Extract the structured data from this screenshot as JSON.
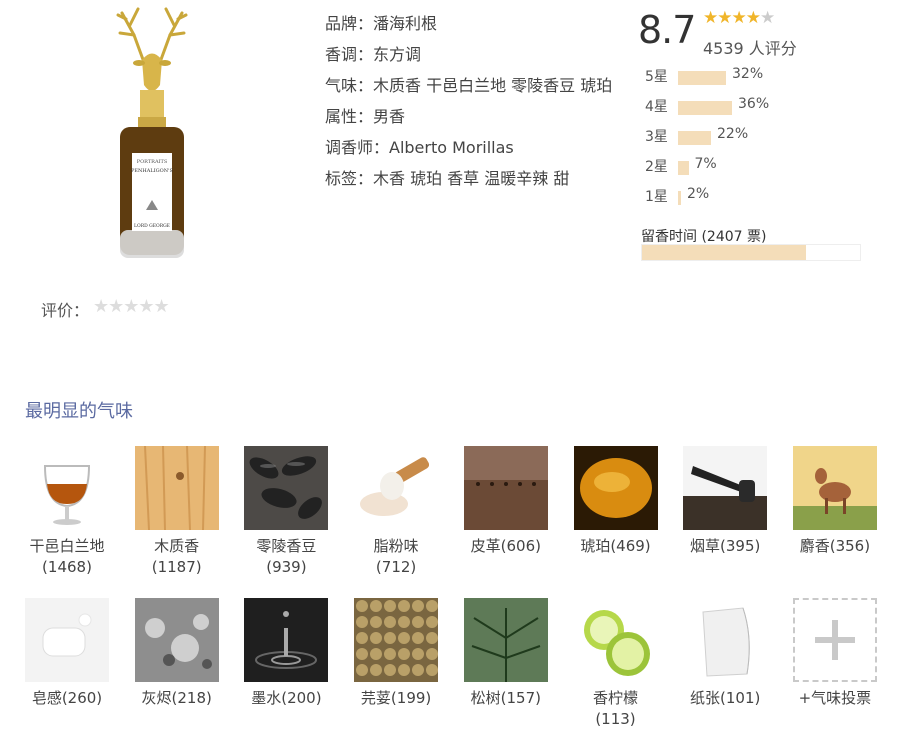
{
  "product": {
    "brand_label": "品牌：潘海利根",
    "family_label": "香调：东方调",
    "scent_label": "气味：木质香 干邑白兰地 零陵香豆 琥珀",
    "gender_label": "属性：男香",
    "perfumer_label": "调香师：Alberto Morillas",
    "tags_label": "标签：木香 琥珀 香草 温暖辛辣 甜",
    "bottle_text_top": "PORTRAITS",
    "bottle_text_brand": "PENHALIGON'S",
    "bottle_text_name": "LORD GEORGE"
  },
  "rating": {
    "score": "8.7",
    "stars_display": "★★★★",
    "half_star": "★",
    "count_text": "4539 人评分",
    "distribution": [
      {
        "label": "5星",
        "pct_text": "32%",
        "pct": 32
      },
      {
        "label": "4星",
        "pct_text": "36%",
        "pct": 36
      },
      {
        "label": "3星",
        "pct_text": "22%",
        "pct": 22
      },
      {
        "label": "2星",
        "pct_text": "7%",
        "pct": 7
      },
      {
        "label": "1星",
        "pct_text": "2%",
        "pct": 2
      }
    ],
    "longevity_label": "留香时间 (2407 票)",
    "longevity_fill": 0.75
  },
  "user_rating": {
    "label": "评价：",
    "stars": "★★★★★"
  },
  "notes_section": {
    "title": "最明显的气味",
    "row1": [
      {
        "name": "干邑白兰地",
        "count": "(1468)",
        "icon": "cognac-icon"
      },
      {
        "name": "木质香",
        "count": "(1187)",
        "icon": "wood-icon"
      },
      {
        "name": "零陵香豆",
        "count": "(939)",
        "icon": "tonka-bean-icon"
      },
      {
        "name": "脂粉味",
        "count": "(712)",
        "icon": "powder-icon"
      },
      {
        "name": "皮革(606)",
        "count": "",
        "icon": "leather-icon"
      },
      {
        "name": "琥珀(469)",
        "count": "",
        "icon": "amber-icon"
      },
      {
        "name": "烟草(395)",
        "count": "",
        "icon": "tobacco-icon"
      },
      {
        "name": "麝香(356)",
        "count": "",
        "icon": "musk-deer-icon"
      }
    ],
    "row2": [
      {
        "name": "皂感(260)",
        "count": "",
        "icon": "soap-icon"
      },
      {
        "name": "灰烬(218)",
        "count": "",
        "icon": "ash-icon"
      },
      {
        "name": "墨水(200)",
        "count": "",
        "icon": "ink-icon"
      },
      {
        "name": "芫荽(199)",
        "count": "",
        "icon": "coriander-icon"
      },
      {
        "name": "松树(157)",
        "count": "",
        "icon": "pine-icon"
      },
      {
        "name": "香柠檬",
        "count": "(113)",
        "icon": "bergamot-icon"
      },
      {
        "name": "纸张(101)",
        "count": "",
        "icon": "paper-icon"
      },
      {
        "name": "+气味投票",
        "count": "",
        "icon": "plus-icon"
      }
    ]
  },
  "colors": {
    "accent_star": "#f0b52a",
    "bar_fill": "#f4ddb9",
    "section_title": "#5b6aa1"
  }
}
